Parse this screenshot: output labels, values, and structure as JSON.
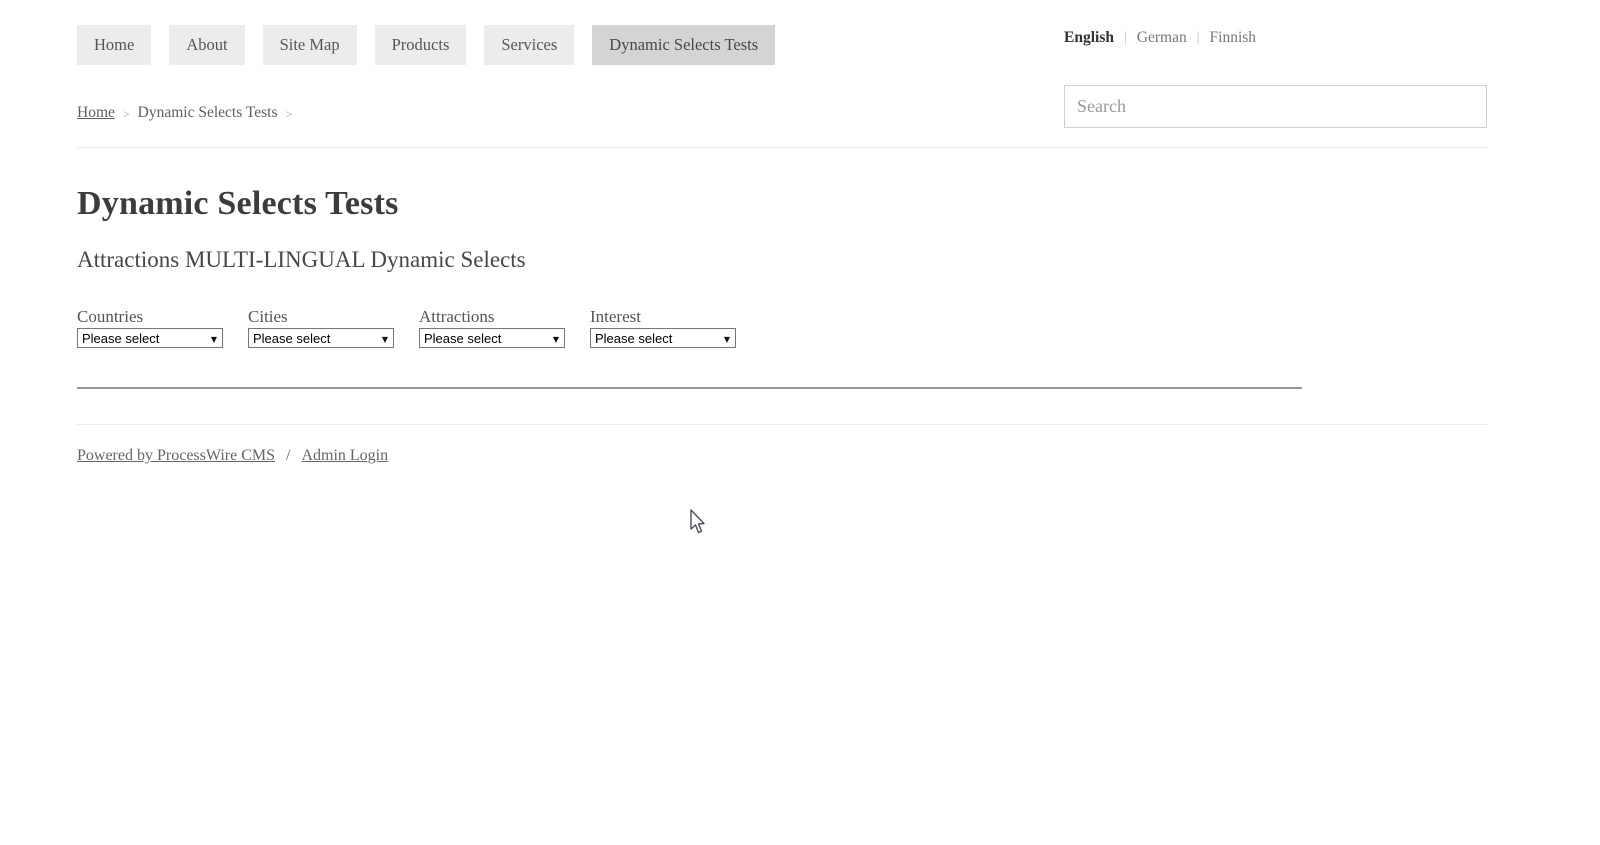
{
  "nav": {
    "items": [
      {
        "label": "Home",
        "active": false
      },
      {
        "label": "About",
        "active": false
      },
      {
        "label": "Site Map",
        "active": false
      },
      {
        "label": "Products",
        "active": false
      },
      {
        "label": "Services",
        "active": false
      },
      {
        "label": "Dynamic Selects Tests",
        "active": true
      }
    ]
  },
  "language_switcher": {
    "separator": "|",
    "items": [
      {
        "label": "English",
        "current": true
      },
      {
        "label": "German",
        "current": false
      },
      {
        "label": "Finnish",
        "current": false
      }
    ]
  },
  "breadcrumb": {
    "separator": ">",
    "items": [
      {
        "label": "Home",
        "link": true
      },
      {
        "label": "Dynamic Selects Tests",
        "link": false
      }
    ]
  },
  "search": {
    "placeholder": "Search",
    "value": ""
  },
  "main": {
    "title": "Dynamic Selects Tests",
    "subtitle": "Attractions MULTI-LINGUAL Dynamic Selects",
    "selects": [
      {
        "label": "Countries",
        "value": "Please select"
      },
      {
        "label": "Cities",
        "value": "Please select"
      },
      {
        "label": "Attractions",
        "value": "Please select"
      },
      {
        "label": "Interest",
        "value": "Please select"
      }
    ],
    "dropdown_arrow_icon": "▼"
  },
  "footer": {
    "powered_by_label": "Powered by ProcessWire CMS",
    "separator": "/",
    "admin_login_label": "Admin Login"
  },
  "colors": {
    "nav_button_bg": "#ececec",
    "nav_button_active_bg": "#d4d4d4",
    "nav_text": "#565656",
    "heading_text": "#3c3c3c",
    "body_text": "#555555",
    "link_text": "#666666",
    "muted_text": "#9a9a9a",
    "rule_light": "#e7e7e7",
    "rule_dark": "#959595",
    "select_border": "#767676",
    "search_border": "#d0d0d0",
    "page_bg": "#ffffff"
  }
}
